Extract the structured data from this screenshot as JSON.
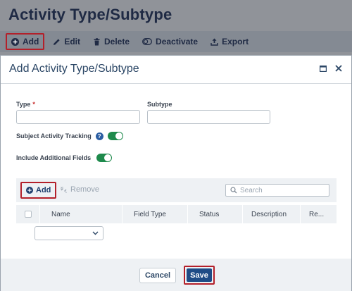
{
  "page": {
    "title": "Activity Type/Subtype"
  },
  "toolbar": {
    "add_label": "Add",
    "edit_label": "Edit",
    "delete_label": "Delete",
    "deactivate_label": "Deactivate",
    "export_label": "Export"
  },
  "modal": {
    "title": "Add Activity Type/Subtype",
    "type_label": "Type",
    "type_required_mark": "*",
    "type_value": "",
    "subtype_label": "Subtype",
    "subtype_value": "",
    "subject_tracking_label": "Subject Activity Tracking",
    "subject_tracking_enabled": true,
    "help_icon_glyph": "?",
    "include_fields_label": "Include Additional Fields",
    "include_fields_enabled": true
  },
  "grid": {
    "add_label": "Add",
    "remove_label": "Remove",
    "search_placeholder": "Search",
    "columns": [
      "Name",
      "Field Type",
      "Status",
      "Description",
      "Re..."
    ],
    "name_select_value": ""
  },
  "footer": {
    "cancel_label": "Cancel",
    "save_label": "Save"
  },
  "colors": {
    "accent": "#1e4c86",
    "highlight_border": "#b3202a",
    "toggle_on": "#1e8a4c"
  },
  "icons": {
    "add": "plus-circle-icon",
    "edit": "pencil-icon",
    "delete": "trash-icon",
    "deactivate": "toggle-off-icon",
    "export": "export-icon",
    "maximize": "maximize-icon",
    "close": "close-icon",
    "remove": "unlink-icon",
    "search": "search-icon",
    "dropdown": "chevron-down-icon"
  }
}
